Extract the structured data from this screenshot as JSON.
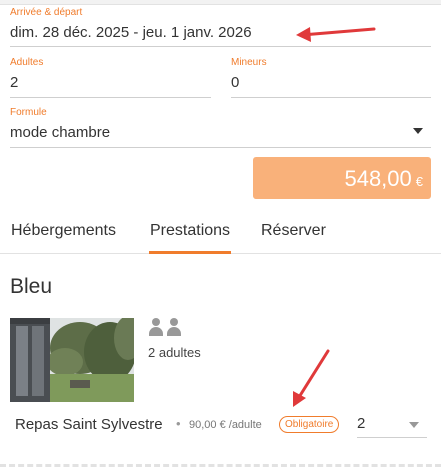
{
  "booking": {
    "dates_label": "Arrivée & départ",
    "dates_value": "dim. 28 déc. 2025 - jeu. 1 janv. 2026",
    "adults_label": "Adultes",
    "adults_value": "2",
    "minors_label": "Mineurs",
    "minors_value": "0",
    "formula_label": "Formule",
    "formula_value": "mode chambre"
  },
  "price": {
    "amount": "548,00",
    "currency": "€"
  },
  "tabs": [
    {
      "label": "Hébergements",
      "active": false
    },
    {
      "label": "Prestations",
      "active": true
    },
    {
      "label": "Réserver",
      "active": false
    }
  ],
  "room": {
    "title": "Bleu",
    "occupancy": "2 adultes"
  },
  "service": {
    "name": "Repas Saint Sylvestre",
    "separator": "•",
    "price": "90,00 € /adulte",
    "badge": "Obligatoire",
    "quantity": "2"
  },
  "colors": {
    "accent": "#f07c2c",
    "price_bg": "#f9b17a",
    "annotation": "#e0393a"
  },
  "icons": [
    "chevron-down-icon",
    "person-icon",
    "red-annotation-arrow"
  ]
}
